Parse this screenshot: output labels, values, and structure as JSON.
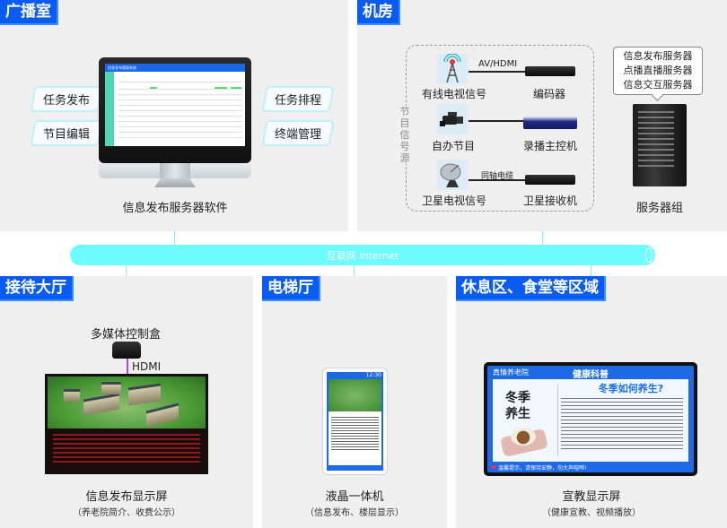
{
  "sections": {
    "broadcast": {
      "tag": "广播室",
      "features": [
        "任务发布",
        "节目编辑",
        "任务排程",
        "终端管理"
      ],
      "monitor_title": "信息发布管理系统",
      "caption": "信息发布服务器软件"
    },
    "machine_room": {
      "tag": "机房",
      "source_group_label": "节目信号源",
      "sources": [
        {
          "label": "有线电视信号",
          "icon": "antenna-tower-icon",
          "link": "AV/HDMI",
          "device": "编码器"
        },
        {
          "label": "自办节目",
          "icon": "video-camera-icon",
          "link": "",
          "device": "录播主控机"
        },
        {
          "label": "卫星电视信号",
          "icon": "satellite-dish-icon",
          "link": "同轴电缆",
          "device": "卫星接收机"
        }
      ],
      "servers_bubble": [
        "信息发布服务器",
        "点播直播服务器",
        "信息交互服务器"
      ],
      "server_caption": "服务器组"
    },
    "network": {
      "label": "互联网 Internet"
    },
    "reception": {
      "tag": "接待大厅",
      "control_box": "多媒体控制盒",
      "link": "HDMI",
      "caption": "信息发布显示屏",
      "subcaption": "（养老院简介、收费公示）"
    },
    "elevator": {
      "tag": "电梯厅",
      "screen_time": "12:30",
      "caption": "液晶一体机",
      "subcaption": "（信息发布、楼层显示）"
    },
    "lounge": {
      "tag": "休息区、食堂等区域",
      "tv_brand": "真情养老院",
      "tv_title": "健康科普",
      "tv_headline": "冬季如何养生?",
      "tv_art": "冬季养生",
      "tv_ticker": "温馨提示，请保持安静，勿大声喧哗!",
      "caption": "宣教显示屏",
      "subcaption": "（健康宣教、视频播放）"
    }
  },
  "colors": {
    "tag_blue": "#0a5cf0",
    "network_cyan": "#6dfdfd",
    "panel_gray": "#efefef",
    "hdmi_purple": "#c040e0"
  }
}
